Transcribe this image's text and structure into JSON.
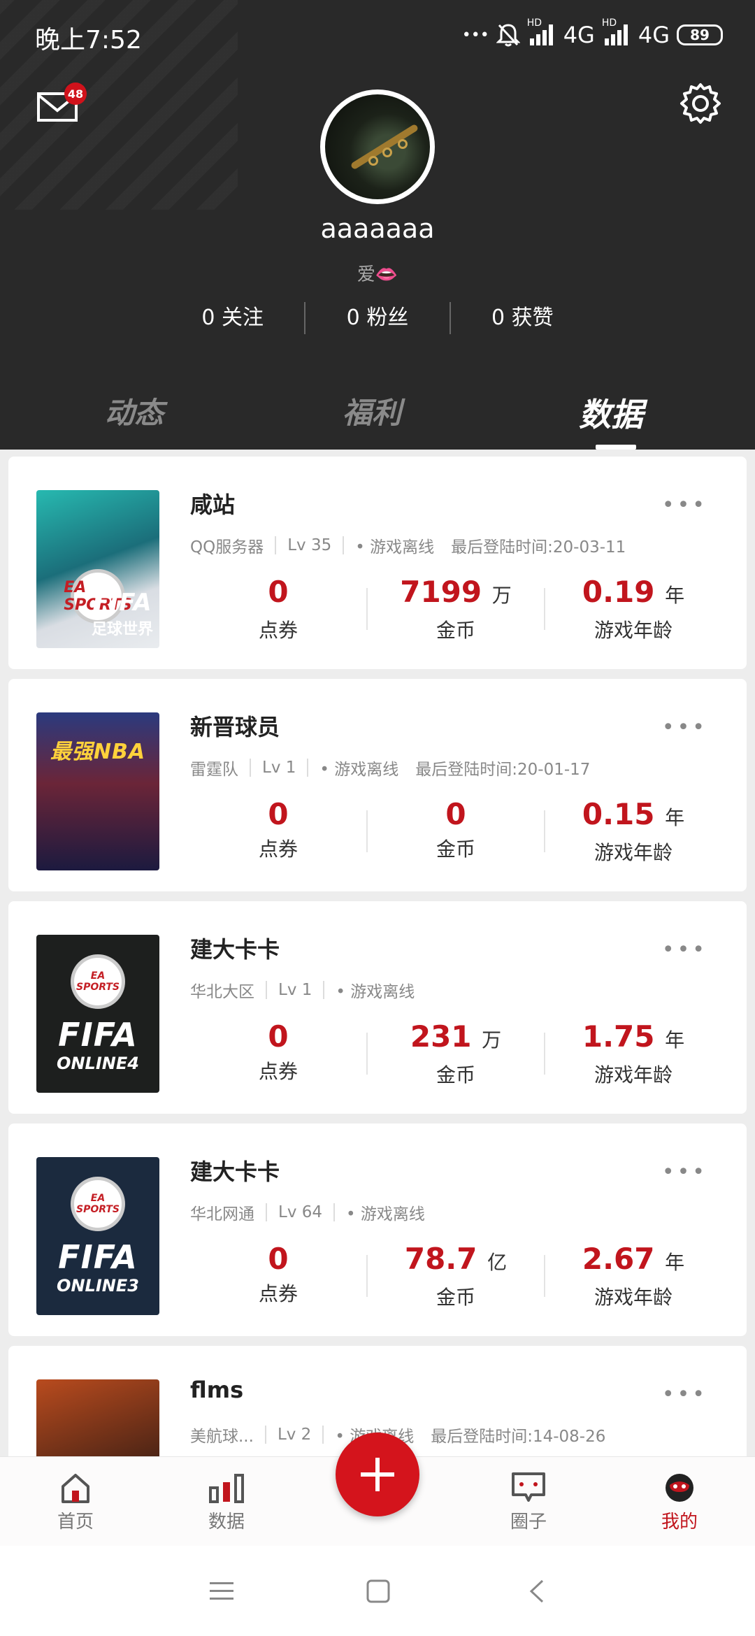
{
  "status_bar": {
    "time": "晚上7:52",
    "dots": "•••",
    "network1": "4G",
    "network2": "4G",
    "hd": "HD",
    "battery": "89"
  },
  "profile": {
    "mail_badge": "48",
    "username": "aaaaaaa",
    "bio": "爱👄",
    "stats": [
      {
        "count": "0",
        "label": "关注"
      },
      {
        "count": "0",
        "label": "粉丝"
      },
      {
        "count": "0",
        "label": "获赞"
      }
    ]
  },
  "tabs": [
    {
      "label": "动态",
      "active": false
    },
    {
      "label": "福利",
      "active": false
    },
    {
      "label": "数据",
      "active": true
    }
  ],
  "cards": [
    {
      "name": "咸站",
      "cover": {
        "brand": "FIFA",
        "sub": "足球世界",
        "badge": "EA SPORTS"
      },
      "server": "QQ服务器",
      "level": "Lv 35",
      "status": "• 游戏离线",
      "last_login": "最后登陆时间:20-03-11",
      "stat1_value": "0",
      "stat1_unit": "",
      "stat1_label": "点券",
      "stat2_value": "7199",
      "stat2_unit": "万",
      "stat2_label": "金币",
      "stat3_value": "0.19",
      "stat3_unit": "年",
      "stat3_label": "游戏年龄"
    },
    {
      "name": "新晋球员",
      "cover": {
        "brand": "最强NBA",
        "sub": "",
        "badge": ""
      },
      "server": "雷霆队",
      "level": "Lv 1",
      "status": "• 游戏离线",
      "last_login": "最后登陆时间:20-01-17",
      "stat1_value": "0",
      "stat1_unit": "",
      "stat1_label": "点券",
      "stat2_value": "0",
      "stat2_unit": "",
      "stat2_label": "金币",
      "stat3_value": "0.15",
      "stat3_unit": "年",
      "stat3_label": "游戏年龄"
    },
    {
      "name": "建大卡卡",
      "cover": {
        "brand": "FIFA",
        "sub": "ONLINE4",
        "badge": "EA SPORTS"
      },
      "server": "华北大区",
      "level": "Lv 1",
      "status": "• 游戏离线",
      "last_login": "",
      "stat1_value": "0",
      "stat1_unit": "",
      "stat1_label": "点券",
      "stat2_value": "231",
      "stat2_unit": "万",
      "stat2_label": "金币",
      "stat3_value": "1.75",
      "stat3_unit": "年",
      "stat3_label": "游戏年龄"
    },
    {
      "name": "建大卡卡",
      "cover": {
        "brand": "FIFA",
        "sub": "ONLINE3",
        "badge": "EA SPORTS"
      },
      "server": "华北网通",
      "level": "Lv 64",
      "status": "• 游戏离线",
      "last_login": "",
      "stat1_value": "0",
      "stat1_unit": "",
      "stat1_label": "点券",
      "stat2_value": "78.7",
      "stat2_unit": "亿",
      "stat2_label": "金币",
      "stat3_value": "2.67",
      "stat3_unit": "年",
      "stat3_label": "游戏年龄"
    },
    {
      "name": "flms",
      "cover": {
        "brand": "",
        "sub": "",
        "badge": ""
      },
      "server": "美航球...",
      "level": "Lv 2",
      "status": "• 游戏离线",
      "last_login": "最后登陆时间:14-08-26",
      "stat1_value": "",
      "stat1_unit": "",
      "stat1_label": "",
      "stat2_value": "",
      "stat2_unit": "",
      "stat2_label": "",
      "stat3_value": "",
      "stat3_unit": "",
      "stat3_label": ""
    }
  ],
  "more_label": "•••",
  "bottom_nav": [
    {
      "label": "首页",
      "icon": "home-icon",
      "active": false
    },
    {
      "label": "数据",
      "icon": "chart-icon",
      "active": false
    },
    {
      "label": "圈子",
      "icon": "chat-icon",
      "active": false
    },
    {
      "label": "我的",
      "icon": "profile-icon",
      "active": true
    }
  ],
  "colors": {
    "accent": "#c1151d",
    "header_bg": "#292929",
    "fab": "#d4141c"
  }
}
